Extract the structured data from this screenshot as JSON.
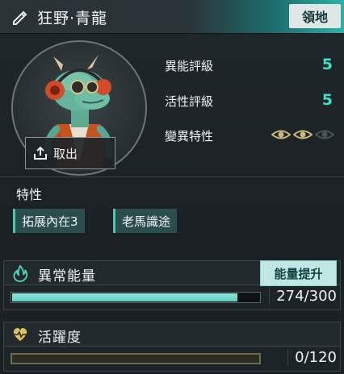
{
  "header": {
    "title": "狂野·青龍",
    "tag": "領地"
  },
  "portrait": {
    "extract_label": "取出"
  },
  "stats": [
    {
      "label": "異能評級",
      "value": "5"
    },
    {
      "label": "活性評級",
      "value": "5"
    },
    {
      "label": "變異特性",
      "eyes_active": 2,
      "eyes_total": 3
    }
  ],
  "traits": {
    "title": "特性",
    "items": [
      "拓展內在3",
      "老馬識途"
    ]
  },
  "energy": {
    "title": "異常能量",
    "button": "能量提升",
    "current": 274,
    "max": 300,
    "display": "274/300"
  },
  "activity": {
    "title": "活躍度",
    "current": 0,
    "max": 120,
    "display": "0/120"
  },
  "colors": {
    "accent": "#3fe0c6",
    "bar": "#6fd8c8",
    "eye_active": "#c9b87a",
    "eye_inactive": "#4a5356"
  }
}
